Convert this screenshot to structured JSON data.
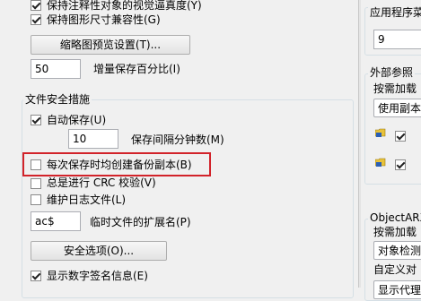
{
  "left": {
    "top_checkboxes": [
      {
        "label": "保持注释性对象的视觉逼真度(Y)",
        "checked": true
      },
      {
        "label": "保持图形尺寸兼容性(G)",
        "checked": true
      }
    ],
    "thumbnail_button": "缩略图预览设置(T)...",
    "incremental_save": {
      "value": "50",
      "label": "增量保存百分比(I)"
    },
    "safety": {
      "title": "文件安全措施",
      "autosave_label": "自动保存(U)",
      "autosave_checked": true,
      "interval_value": "10",
      "interval_label": "保存间隔分钟数(M)",
      "backup_label": "每次保存时均创建备份副本(B)",
      "backup_checked": false,
      "crc_label": "总是进行 CRC 校验(V)",
      "crc_checked": false,
      "log_label": "维护日志文件(L)",
      "log_checked": false,
      "ext_value": "ac$",
      "ext_label": "临时文件的扩展名(P)",
      "security_button": "安全选项(O)...",
      "signature_label": "显示数字签名信息(E)",
      "signature_checked": true
    }
  },
  "right": {
    "app_label": "应用程序菜",
    "app_value": "9",
    "xref_title": "外部参照",
    "xref_demand_label": "按需加载",
    "xref_select_value": "使用副本",
    "objectarx_title": "ObjectARX",
    "arx_demand_label": "按需加载",
    "arx_select_value": "对象检测",
    "custom_label": "自定义对",
    "proxy_select_value": "显示代理"
  },
  "colors": {
    "highlight": "#d2232a",
    "background": "#f0f0f0"
  }
}
